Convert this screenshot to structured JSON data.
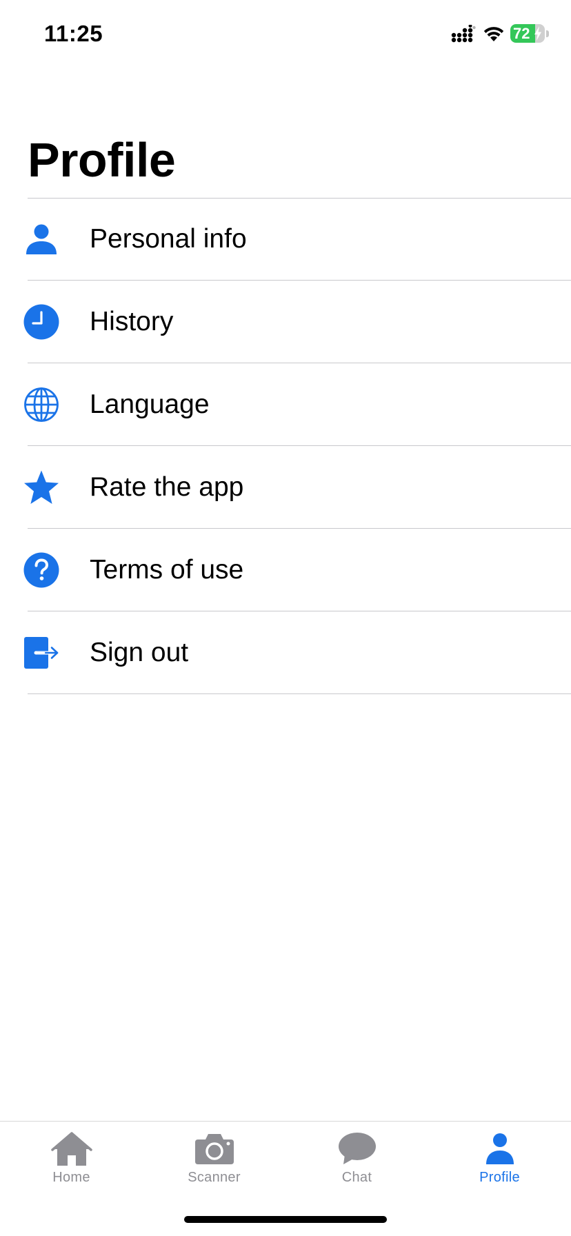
{
  "status_bar": {
    "time": "11:25",
    "battery_percent": "72",
    "battery_level": 0.72,
    "battery_color": "#34c759",
    "icons": [
      "signal-icon",
      "wifi-icon",
      "battery-icon",
      "charging-bolt-icon"
    ]
  },
  "page": {
    "title": "Profile"
  },
  "theme": {
    "accent": "#1a73e8",
    "inactive": "#8e8e93",
    "divider": "#c8c8cc"
  },
  "menu": {
    "items": [
      {
        "label": "Personal info",
        "icon": "person-icon"
      },
      {
        "label": "History",
        "icon": "clock-icon"
      },
      {
        "label": "Language",
        "icon": "globe-icon"
      },
      {
        "label": "Rate the app",
        "icon": "star-icon"
      },
      {
        "label": "Terms of use",
        "icon": "question-icon"
      },
      {
        "label": "Sign out",
        "icon": "sign-out-icon"
      }
    ]
  },
  "tab_bar": {
    "active": "Profile",
    "tabs": [
      {
        "label": "Home",
        "icon": "house-icon"
      },
      {
        "label": "Scanner",
        "icon": "camera-icon"
      },
      {
        "label": "Chat",
        "icon": "chat-bubble-icon"
      },
      {
        "label": "Profile",
        "icon": "person-icon"
      }
    ]
  }
}
